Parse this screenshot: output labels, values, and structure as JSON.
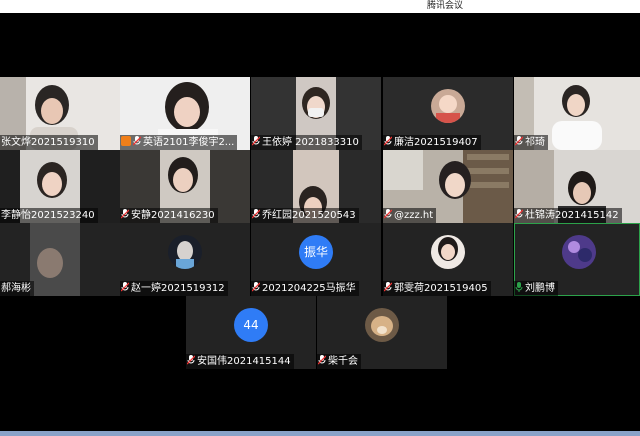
{
  "window": {
    "title": "腾讯会议"
  },
  "participants": [
    {
      "name": "张文烨2021519310"
    },
    {
      "name": "英语2101李俊宇2..."
    },
    {
      "name": "王依婷  2021833310"
    },
    {
      "name": "廉洁2021519407"
    },
    {
      "name": "祁琦"
    },
    {
      "name": "李静怡2021523240"
    },
    {
      "name": "安静2021416230"
    },
    {
      "name": "乔红园2021520543"
    },
    {
      "name": "@zzz.ht"
    },
    {
      "name": "杜锦涛2021415142"
    },
    {
      "name": "郝海彬"
    },
    {
      "name": "赵一婷2021519312"
    },
    {
      "name": "2021204225马振华",
      "avatar_text": "振华"
    },
    {
      "name": "郭雯荷2021519405"
    },
    {
      "name": "刘鹏博"
    },
    {
      "name": "安国伟2021415144",
      "avatar_text": "44"
    },
    {
      "name": "柴千会"
    }
  ],
  "colors": {
    "avatar_blue": "#2f7cf6",
    "active_border": "#2ca24a",
    "host_badge": "#f07f1a"
  }
}
